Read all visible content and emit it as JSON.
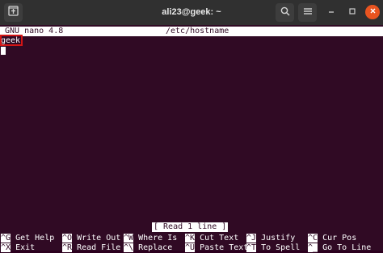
{
  "window": {
    "title": "ali23@geek: ~",
    "new_tab_icon": "new-tab-icon",
    "search_icon": "search-icon",
    "menu_icon": "hamburger-menu-icon",
    "minimize_icon": "minimize-icon",
    "maximize_icon": "maximize-icon",
    "close_icon": "close-icon"
  },
  "nano": {
    "version_label": "GNU nano 4.8",
    "filename": "/etc/hostname",
    "content_line": "geek",
    "status_message": "[ Read 1 line ]",
    "shortcuts_row1": [
      {
        "key": "^G",
        "label": "Get Help"
      },
      {
        "key": "^O",
        "label": "Write Out"
      },
      {
        "key": "^W",
        "label": "Where Is"
      },
      {
        "key": "^K",
        "label": "Cut Text"
      },
      {
        "key": "^J",
        "label": "Justify"
      },
      {
        "key": "^C",
        "label": "Cur Pos"
      }
    ],
    "shortcuts_row2": [
      {
        "key": "^X",
        "label": "Exit"
      },
      {
        "key": "^R",
        "label": "Read File"
      },
      {
        "key": "^\\",
        "label": "Replace"
      },
      {
        "key": "^U",
        "label": "Paste Text"
      },
      {
        "key": "^T",
        "label": "To Spell"
      },
      {
        "key": "^_",
        "label": "Go To Line"
      }
    ]
  },
  "colors": {
    "terminal_bg": "#300a24",
    "titlebar_bg": "#303030",
    "highlight_border": "#d31515",
    "close_button": "#e95420"
  }
}
